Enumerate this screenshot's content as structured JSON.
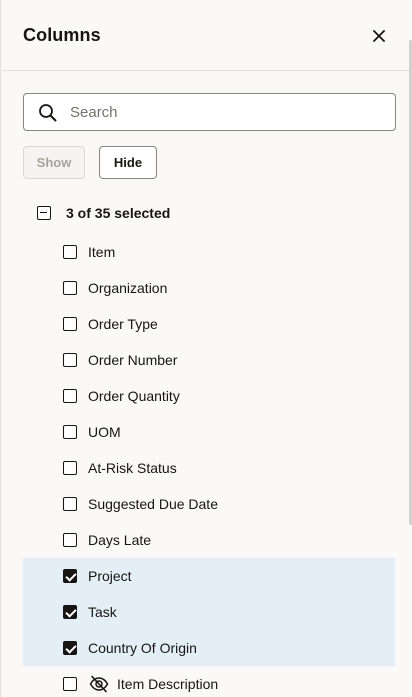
{
  "panel": {
    "title": "Columns",
    "close_icon": "close-icon"
  },
  "search": {
    "placeholder": "Search",
    "value": "",
    "icon": "search-icon"
  },
  "actions": {
    "show_label": "Show",
    "show_disabled": true,
    "hide_label": "Hide"
  },
  "selection": {
    "summary": "3 of 35 selected",
    "state": "indeterminate"
  },
  "columns": [
    {
      "label": "Item",
      "checked": false,
      "hidden": false
    },
    {
      "label": "Organization",
      "checked": false,
      "hidden": false
    },
    {
      "label": "Order Type",
      "checked": false,
      "hidden": false
    },
    {
      "label": "Order Number",
      "checked": false,
      "hidden": false
    },
    {
      "label": "Order Quantity",
      "checked": false,
      "hidden": false
    },
    {
      "label": "UOM",
      "checked": false,
      "hidden": false
    },
    {
      "label": "At-Risk Status",
      "checked": false,
      "hidden": false
    },
    {
      "label": "Suggested Due Date",
      "checked": false,
      "hidden": false
    },
    {
      "label": "Days Late",
      "checked": false,
      "hidden": false
    },
    {
      "label": "Project",
      "checked": true,
      "hidden": false
    },
    {
      "label": "Task",
      "checked": true,
      "hidden": false
    },
    {
      "label": "Country Of Origin",
      "checked": true,
      "hidden": false
    },
    {
      "label": "Item Description",
      "checked": false,
      "hidden": true
    }
  ],
  "colors": {
    "selected_row": "#e4eff5",
    "text": "#161513",
    "border": "#8a8580"
  }
}
